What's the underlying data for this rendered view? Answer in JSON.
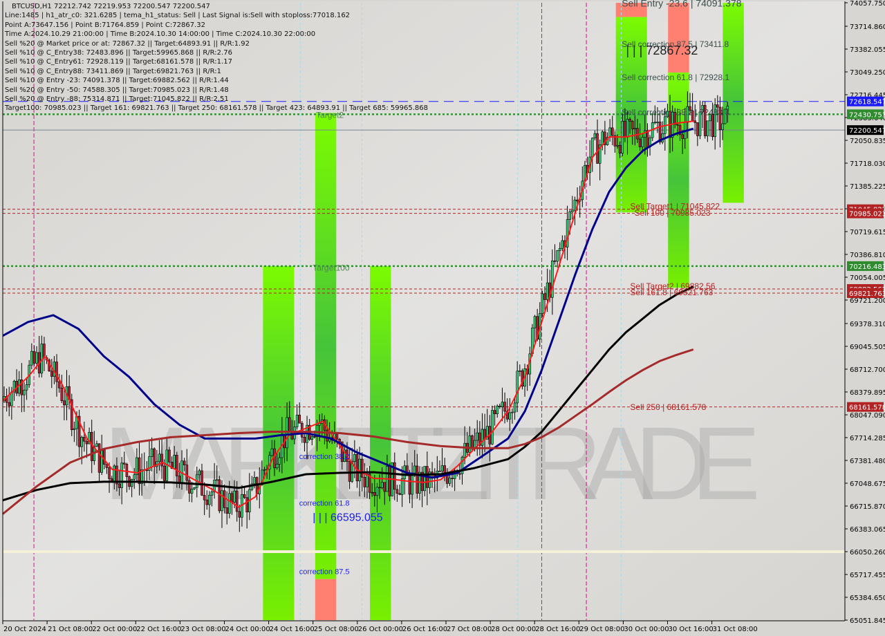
{
  "chart_data": {
    "type": "candlestick",
    "symbol": "BTCUSD",
    "timeframe": "H1",
    "ohlc_header": {
      "open": 72212.742,
      "high": 72219.953,
      "low": 72200.547,
      "close": 72200.547
    },
    "title": "BTCUSD,H1  72212.742 72219.953 72200.547 72200.547",
    "ylim": [
      65051.845,
      74057.75
    ],
    "y_ticks": [
      "74057.750",
      "73714.860",
      "73382.055",
      "73049.250",
      "72716.445",
      "72383.640",
      "72050.835",
      "71718.030",
      "71385.225",
      "71052.420",
      "70719.615",
      "70386.810",
      "70054.005",
      "69721.200",
      "69378.310",
      "69045.505",
      "68712.700",
      "68379.895",
      "68047.090",
      "67714.285",
      "67381.480",
      "67048.675",
      "66715.870",
      "66383.065",
      "66050.260",
      "65717.455",
      "65384.650",
      "65051.845"
    ],
    "x_ticks": [
      "20 Oct 2024",
      "21 Oct 08:00",
      "22 Oct 00:00",
      "22 Oct 16:00",
      "23 Oct 08:00",
      "24 Oct 00:00",
      "24 Oct 16:00",
      "25 Oct 08:00",
      "26 Oct 00:00",
      "26 Oct 16:00",
      "27 Oct 08:00",
      "28 Oct 00:00",
      "28 Oct 16:00",
      "29 Oct 08:00",
      "30 Oct 00:00",
      "30 Oct 16:00",
      "31 Oct 08:00"
    ],
    "price_tags": [
      {
        "value": 72618.547,
        "label": "72618.547",
        "color": "#1a1aff",
        "line": "dashed"
      },
      {
        "value": 72430.751,
        "label": "72430.751",
        "color": "#2e8b2e",
        "line": "dotted"
      },
      {
        "value": 72200.547,
        "label": "72200.547",
        "color": "#000000",
        "line": "solid"
      },
      {
        "value": 71045.822,
        "label": "71045.822",
        "color": "#b22222",
        "line": "dashed"
      },
      {
        "value": 70985.023,
        "label": "70985.023",
        "color": "#b22222",
        "line": "dashed"
      },
      {
        "value": 70216.483,
        "label": "70216.483",
        "color": "#2e8b2e",
        "line": "dotted"
      },
      {
        "value": 69882.562,
        "label": "69882.562",
        "color": "#b22222",
        "line": "dashed"
      },
      {
        "value": 69821.763,
        "label": "69821.763",
        "color": "#b22222",
        "line": "dashed"
      },
      {
        "value": 68161.578,
        "label": "68161.578",
        "color": "#b22222",
        "line": "dashed"
      }
    ],
    "level_labels": [
      {
        "text": "Sell Entry -23.6 | 74091.378",
        "value": 74000,
        "x": 0.735
      },
      {
        "text": "Sell correction 87.5 | 73411.8",
        "value": 73411.8,
        "x": 0.735
      },
      {
        "text": "| | | 72867.32",
        "value": 73300,
        "x": 0.74
      },
      {
        "text": "Sell correction 61.8 | 72928.1",
        "value": 72928.1,
        "x": 0.735
      },
      {
        "text": "Sell correction 38.2 | 72483.8",
        "value": 72420,
        "x": 0.735
      },
      {
        "text": "Sell Target1 | 71045.822",
        "value": 71045.822,
        "x": 0.745
      },
      {
        "text": "Sell 100 | 70985.023",
        "value": 70950,
        "x": 0.75
      },
      {
        "text": "Sell Target2 | 69882.56",
        "value": 69882.56,
        "x": 0.745
      },
      {
        "text": "Sell 161.8 | 69821.763",
        "value": 69790,
        "x": 0.745
      },
      {
        "text": "Sell 250 | 68161.578",
        "value": 68120,
        "x": 0.745
      },
      {
        "text": "Target2",
        "value": 72380,
        "x": 0.372
      },
      {
        "text": "Target100",
        "value": 70150,
        "x": 0.368
      },
      {
        "text": "correction 38.2",
        "value": 67400,
        "x": 0.352
      },
      {
        "text": "correction 61.8",
        "value": 66720,
        "x": 0.352
      },
      {
        "text": "| | | 66595.055",
        "value": 66500,
        "x": 0.368
      },
      {
        "text": "correction 87.5",
        "value": 65720,
        "x": 0.352
      }
    ],
    "info_panel": [
      "Line:1485 | h1_atr_c0: 321.6285 | tema_h1_status: Sell | Last Signal is:Sell with stoploss:77018.162",
      "Point A:73647.156 | Point B:71764.859 | Point C:72867.32",
      "Time A:2024.10.29 21:00:00 | Time B:2024.10.30 14:00:00 | Time C:2024.10.30 22:00:00",
      "Sell %20 @ Market price or at: 72867.32 || Target:64893.91 || R/R:1.92",
      "Sell %10 @ C_Entry38: 72483.896 || Target:59965.868 || R/R:2.76",
      "Sell %10 @ C_Entry61: 72928.119 || Target:68161.578 || R/R:1.17",
      "Sell %10 @ C_Entry88: 73411.869 || Target:69821.763 || R/R:1",
      "Sell %10 @ Entry -23: 74091.378 || Target:69882.562 || R/R:1.44",
      "Sell %20 @ Entry -50: 74588.305 || Target:70985.023 || R/R:1.48",
      "Sell %20 @ Entry -88: 75314.871 || Target:71045.822 || R/R:2.51",
      "Target100: 70985.023 || Target 161: 69821.763 || Target 250: 68161.578 || Target 423: 64893.91 || Target 685: 59965.868"
    ],
    "watermark": "MARKETZITRADE",
    "series": [
      {
        "name": "EMA fast (red)",
        "color": "#ff1a1a",
        "points": [
          [
            0,
            68250
          ],
          [
            0.03,
            68600
          ],
          [
            0.05,
            68900
          ],
          [
            0.07,
            68500
          ],
          [
            0.1,
            67700
          ],
          [
            0.13,
            67250
          ],
          [
            0.16,
            67200
          ],
          [
            0.19,
            67350
          ],
          [
            0.22,
            67150
          ],
          [
            0.25,
            66950
          ],
          [
            0.28,
            66700
          ],
          [
            0.3,
            66850
          ],
          [
            0.32,
            67400
          ],
          [
            0.34,
            67750
          ],
          [
            0.36,
            67850
          ],
          [
            0.38,
            67950
          ],
          [
            0.4,
            67600
          ],
          [
            0.42,
            67250
          ],
          [
            0.44,
            67120
          ],
          [
            0.46,
            67110
          ],
          [
            0.48,
            67080
          ],
          [
            0.5,
            67060
          ],
          [
            0.52,
            67100
          ],
          [
            0.54,
            67300
          ],
          [
            0.56,
            67550
          ],
          [
            0.58,
            67780
          ],
          [
            0.6,
            68100
          ],
          [
            0.62,
            68600
          ],
          [
            0.64,
            69400
          ],
          [
            0.66,
            70200
          ],
          [
            0.68,
            71000
          ],
          [
            0.7,
            71800
          ],
          [
            0.72,
            72100
          ],
          [
            0.74,
            72100
          ],
          [
            0.76,
            72150
          ],
          [
            0.78,
            72250
          ],
          [
            0.8,
            72300
          ],
          [
            0.82,
            72330
          ]
        ]
      },
      {
        "name": "MA mid (navy)",
        "color": "#00008b",
        "points": [
          [
            0,
            69200
          ],
          [
            0.03,
            69400
          ],
          [
            0.06,
            69500
          ],
          [
            0.09,
            69300
          ],
          [
            0.12,
            68900
          ],
          [
            0.15,
            68600
          ],
          [
            0.18,
            68200
          ],
          [
            0.21,
            67900
          ],
          [
            0.24,
            67700
          ],
          [
            0.27,
            67700
          ],
          [
            0.3,
            67700
          ],
          [
            0.33,
            67750
          ],
          [
            0.36,
            67780
          ],
          [
            0.39,
            67700
          ],
          [
            0.42,
            67500
          ],
          [
            0.45,
            67350
          ],
          [
            0.48,
            67200
          ],
          [
            0.51,
            67130
          ],
          [
            0.54,
            67200
          ],
          [
            0.57,
            67450
          ],
          [
            0.6,
            67700
          ],
          [
            0.62,
            68100
          ],
          [
            0.64,
            68700
          ],
          [
            0.66,
            69400
          ],
          [
            0.68,
            70100
          ],
          [
            0.7,
            70750
          ],
          [
            0.72,
            71300
          ],
          [
            0.74,
            71650
          ],
          [
            0.76,
            71900
          ],
          [
            0.78,
            72050
          ],
          [
            0.8,
            72150
          ],
          [
            0.82,
            72220
          ]
        ]
      },
      {
        "name": "MA slow (black)",
        "color": "#000000",
        "points": [
          [
            0,
            66800
          ],
          [
            0.04,
            66950
          ],
          [
            0.08,
            67050
          ],
          [
            0.12,
            67070
          ],
          [
            0.16,
            67070
          ],
          [
            0.2,
            67060
          ],
          [
            0.24,
            67030
          ],
          [
            0.28,
            66980
          ],
          [
            0.32,
            67070
          ],
          [
            0.36,
            67180
          ],
          [
            0.4,
            67200
          ],
          [
            0.44,
            67210
          ],
          [
            0.48,
            67170
          ],
          [
            0.52,
            67180
          ],
          [
            0.56,
            67270
          ],
          [
            0.6,
            67400
          ],
          [
            0.62,
            67580
          ],
          [
            0.64,
            67800
          ],
          [
            0.66,
            68100
          ],
          [
            0.68,
            68400
          ],
          [
            0.7,
            68700
          ],
          [
            0.72,
            69000
          ],
          [
            0.74,
            69250
          ],
          [
            0.76,
            69450
          ],
          [
            0.78,
            69650
          ],
          [
            0.8,
            69800
          ],
          [
            0.82,
            69920
          ]
        ]
      },
      {
        "name": "MA 200 (brown)",
        "color": "#a52a2a",
        "points": [
          [
            0,
            66600
          ],
          [
            0.04,
            67000
          ],
          [
            0.08,
            67350
          ],
          [
            0.12,
            67550
          ],
          [
            0.16,
            67650
          ],
          [
            0.2,
            67720
          ],
          [
            0.24,
            67750
          ],
          [
            0.28,
            67780
          ],
          [
            0.32,
            67800
          ],
          [
            0.36,
            67800
          ],
          [
            0.4,
            67780
          ],
          [
            0.44,
            67730
          ],
          [
            0.48,
            67650
          ],
          [
            0.52,
            67590
          ],
          [
            0.56,
            67560
          ],
          [
            0.6,
            67560
          ],
          [
            0.62,
            67620
          ],
          [
            0.64,
            67720
          ],
          [
            0.66,
            67860
          ],
          [
            0.68,
            68030
          ],
          [
            0.7,
            68200
          ],
          [
            0.72,
            68380
          ],
          [
            0.74,
            68550
          ],
          [
            0.76,
            68700
          ],
          [
            0.78,
            68830
          ],
          [
            0.8,
            68920
          ],
          [
            0.82,
            69000
          ]
        ]
      }
    ],
    "zones": [
      {
        "type": "green",
        "x0": 0.309,
        "x1": 0.346,
        "y0": 70216,
        "y1": 65051
      },
      {
        "type": "green",
        "x0": 0.371,
        "x1": 0.396,
        "y0": 72450,
        "y1": 65650
      },
      {
        "type": "red",
        "x0": 0.371,
        "x1": 0.396,
        "y0": 65650,
        "y1": 65051
      },
      {
        "type": "green",
        "x0": 0.436,
        "x1": 0.461,
        "y0": 70216,
        "y1": 65051
      },
      {
        "type": "red",
        "x0": 0.728,
        "x1": 0.765,
        "y0": 74057,
        "y1": 73850
      },
      {
        "type": "green",
        "x0": 0.728,
        "x1": 0.765,
        "y0": 73850,
        "y1": 71000
      },
      {
        "type": "red",
        "x0": 0.79,
        "x1": 0.815,
        "y0": 74057,
        "y1": 73040
      },
      {
        "type": "green",
        "x0": 0.79,
        "x1": 0.815,
        "y0": 73040,
        "y1": 69900
      },
      {
        "type": "green",
        "x0": 0.855,
        "x1": 0.88,
        "y0": 74057,
        "y1": 71140
      }
    ],
    "vlines": [
      0.037,
      0.64,
      0.693
    ],
    "colors": {
      "background": "#d8d6d2",
      "bull_candle": "#2ecc71",
      "bear_candle": "#b22234",
      "green_zone": "#6be01a",
      "red_zone": "#ff8070"
    }
  }
}
